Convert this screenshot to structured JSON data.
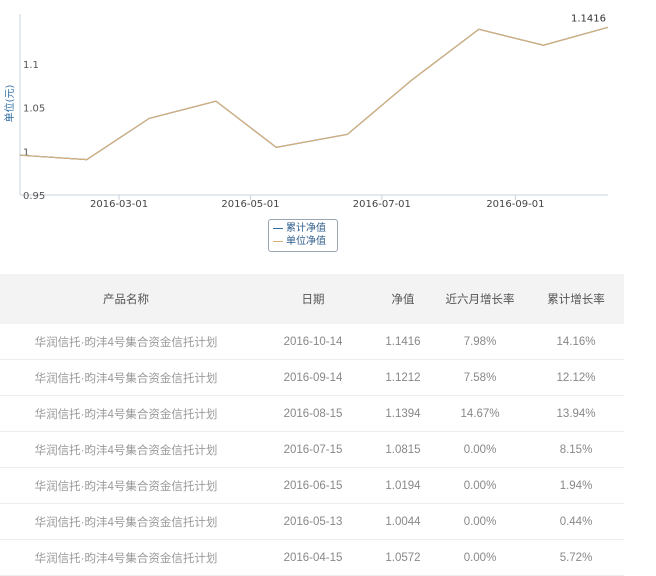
{
  "chart_data": {
    "type": "line",
    "ylabel": "单位(元)",
    "ylim": [
      0.95,
      1.15
    ],
    "yticks": [
      0.95,
      1,
      1.05,
      1.1
    ],
    "ytick_labels": [
      "0.95",
      "1",
      "1.05",
      "1.1"
    ],
    "xtick_labels": [
      "2016-03-01",
      "2016-05-01",
      "2016-07-01",
      "2016-09-01"
    ],
    "x": [
      "2016-01-15",
      "2016-02-15",
      "2016-03-15",
      "2016-04-15",
      "2016-05-13",
      "2016-06-15",
      "2016-07-15",
      "2016-08-15",
      "2016-09-14",
      "2016-10-14"
    ],
    "series": [
      {
        "name": "累计净值",
        "color": "#2e6da4",
        "values": [
          0.9955,
          0.9905,
          1.0375,
          1.0572,
          1.0044,
          1.0194,
          1.0815,
          1.1394,
          1.1212,
          1.1416
        ]
      },
      {
        "name": "单位净值",
        "color": "#d8b07a",
        "values": [
          0.9955,
          0.9905,
          1.0375,
          1.0572,
          1.0044,
          1.0194,
          1.0815,
          1.1394,
          1.1212,
          1.1416
        ]
      }
    ],
    "last_value_label": "1.1416",
    "grid": false,
    "legend_position": "bottom-center"
  },
  "legend": {
    "items": [
      {
        "label": "累计净值",
        "color": "#2e6da4"
      },
      {
        "label": "单位净值",
        "color": "#d8b07a"
      }
    ]
  },
  "table": {
    "headers": {
      "name": "产品名称",
      "date": "日期",
      "nav": "净值",
      "growth6m": "近六月增长率",
      "cumgrowth": "累计增长率"
    },
    "rows": [
      {
        "name": "华润信托·昀沣4号集合资金信托计划",
        "date": "2016-10-14",
        "nav": "1.1416",
        "growth6m": "7.98%",
        "cumgrowth": "14.16%"
      },
      {
        "name": "华润信托·昀沣4号集合资金信托计划",
        "date": "2016-09-14",
        "nav": "1.1212",
        "growth6m": "7.58%",
        "cumgrowth": "12.12%"
      },
      {
        "name": "华润信托·昀沣4号集合资金信托计划",
        "date": "2016-08-15",
        "nav": "1.1394",
        "growth6m": "14.67%",
        "cumgrowth": "13.94%"
      },
      {
        "name": "华润信托·昀沣4号集合资金信托计划",
        "date": "2016-07-15",
        "nav": "1.0815",
        "growth6m": "0.00%",
        "cumgrowth": "8.15%"
      },
      {
        "name": "华润信托·昀沣4号集合资金信托计划",
        "date": "2016-06-15",
        "nav": "1.0194",
        "growth6m": "0.00%",
        "cumgrowth": "1.94%"
      },
      {
        "name": "华润信托·昀沣4号集合资金信托计划",
        "date": "2016-05-13",
        "nav": "1.0044",
        "growth6m": "0.00%",
        "cumgrowth": "0.44%"
      },
      {
        "name": "华润信托·昀沣4号集合资金信托计划",
        "date": "2016-04-15",
        "nav": "1.0572",
        "growth6m": "0.00%",
        "cumgrowth": "5.72%"
      }
    ]
  }
}
